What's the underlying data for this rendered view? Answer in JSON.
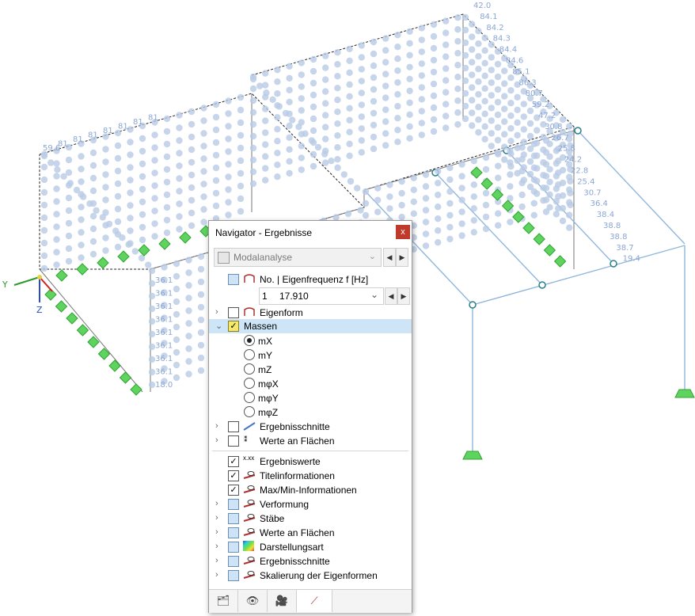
{
  "navigator": {
    "title": "Navigator - Ergebnisse",
    "close_label": "x",
    "analysis_type": "Modalanalyse",
    "mode_header": "No. | Eigenfrequenz f [Hz]",
    "mode_no": "1",
    "mode_freq": "17.910",
    "items": {
      "eigenform": "Eigenform",
      "massen": "Massen",
      "ergebnisschnitte": "Ergebnisschnitte",
      "werte_flaechen": "Werte an Flächen"
    },
    "mass_options": [
      "mX",
      "mY",
      "mZ",
      "mφX",
      "mφY",
      "mφZ"
    ],
    "display": {
      "ergebniswerte": "Ergebniswerte",
      "titelinfo": "Titelinformationen",
      "maxmin": "Max/Min-Informationen",
      "verformung": "Verformung",
      "staebe": "Stäbe",
      "werte_flaechen": "Werte an Flächen",
      "darstellungsart": "Darstellungsart",
      "ergebnisschnitte": "Ergebnisschnitte",
      "skalierung": "Skalierung der Eigenformen"
    }
  },
  "scene": {
    "axis_y": "Y",
    "axis_z": "Z",
    "labels_right": [
      "42.0",
      "84.1",
      "84.2",
      "84.3",
      "84.4",
      "84.6",
      "85.1",
      "86.3",
      "80.7",
      "59.2",
      "47.2",
      "30.8",
      "26.7",
      "25.8",
      "24.2",
      "22.8",
      "25.4",
      "30.7",
      "36.4",
      "38.4",
      "38.8",
      "38.8",
      "38.7",
      "19.4"
    ],
    "labels_left": [
      "36.1",
      "36.1",
      "36.1",
      "36.1",
      "36.1",
      "36.1",
      "36.1",
      "36.1",
      "18.0"
    ],
    "labels_top_left": [
      "59.6",
      "81",
      "81",
      "81",
      "81",
      "81",
      "81",
      "81"
    ],
    "colors": {
      "dots": "#b9cbe6",
      "labels": "#8aa6d4",
      "frame": "#8fb7dd",
      "support": "#5fd35f"
    }
  }
}
